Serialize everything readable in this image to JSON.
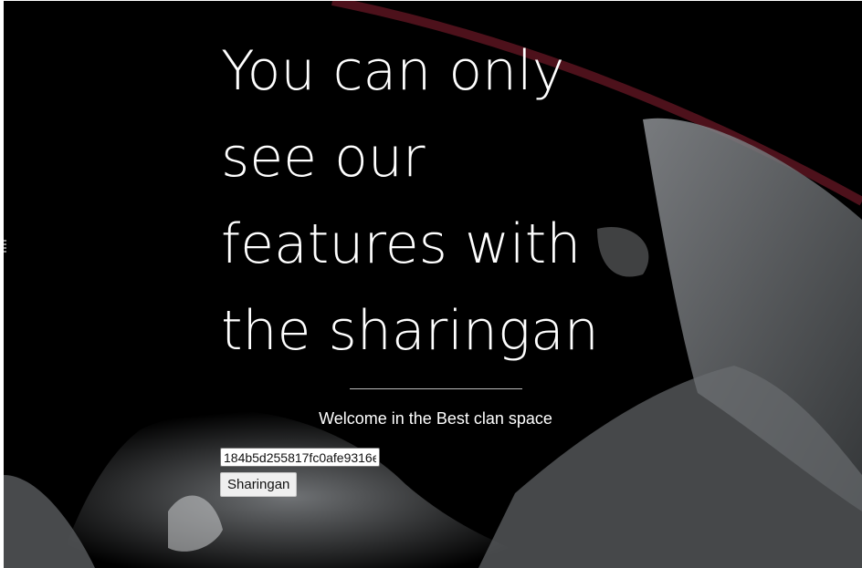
{
  "hero": {
    "lines": [
      "You can only",
      "see our",
      "features with",
      "the sharingan"
    ]
  },
  "subtitle": "Welcome in the Best clan space",
  "form": {
    "input_value": "184b5d255817fc0afe9316e",
    "button_label": "Sharingan"
  },
  "colors": {
    "background": "#000000",
    "text": "#ffffff",
    "streak": "#7a1a24"
  }
}
